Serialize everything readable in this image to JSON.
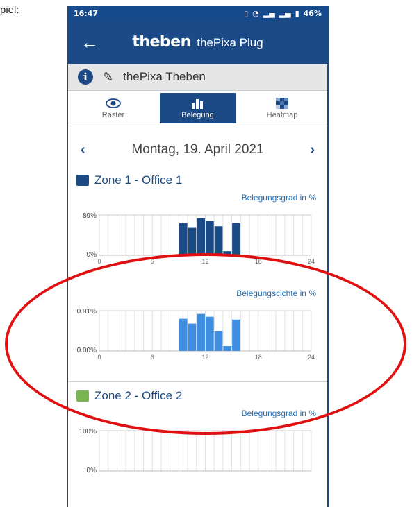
{
  "caption": "piel:",
  "status_bar": {
    "time": "16:47",
    "battery": "46%",
    "icons": [
      "vibrate-icon",
      "wifi-icon",
      "signal-icon",
      "signal-icon",
      "battery-icon"
    ]
  },
  "app": {
    "brand": "theben",
    "product": "thePixa Plug"
  },
  "device": {
    "name": "thePixa Theben"
  },
  "tabs": [
    {
      "label": "Raster",
      "icon": "eye-icon",
      "active": false
    },
    {
      "label": "Belegung",
      "icon": "bar-chart-icon",
      "active": true
    },
    {
      "label": "Heatmap",
      "icon": "heatmap-icon",
      "active": false
    }
  ],
  "date": {
    "text": "Montag, 19. April 2021",
    "prev": "‹",
    "next": "›"
  },
  "zones": [
    {
      "title": "Zone 1 - Office 1",
      "color": "#1b4a86"
    },
    {
      "title": "Zone 2 - Office 2",
      "color": "#7bb553"
    }
  ],
  "chart_data": [
    {
      "type": "bar",
      "ylabel_top": "Belegungsgrad in %",
      "y_top_label": "89%",
      "y_bottom_label": "0%",
      "x_ticks": [
        "0",
        "6",
        "12",
        "18",
        "24"
      ],
      "x": [
        9,
        10,
        11,
        12,
        13,
        14,
        15
      ],
      "values": [
        0.8,
        0.68,
        0.92,
        0.85,
        0.72,
        0.1,
        0.8
      ],
      "color": "#1b4a86"
    },
    {
      "type": "bar",
      "ylabel_top": "Belegungscichte in %",
      "y_top_label": "0.91%",
      "y_bottom_label": "0.00%",
      "x_ticks": [
        "0",
        "6",
        "12",
        "18",
        "24"
      ],
      "x": [
        9,
        10,
        11,
        12,
        13,
        14,
        15
      ],
      "values": [
        0.8,
        0.68,
        0.92,
        0.85,
        0.5,
        0.12,
        0.78
      ],
      "color": "#3f8ee0"
    },
    {
      "type": "bar",
      "ylabel_top": "Belegungsgrad in %",
      "y_top_label": "100%",
      "y_bottom_label": "0%",
      "x_ticks": [],
      "x": [],
      "values": [],
      "color": "#7bb553"
    }
  ]
}
